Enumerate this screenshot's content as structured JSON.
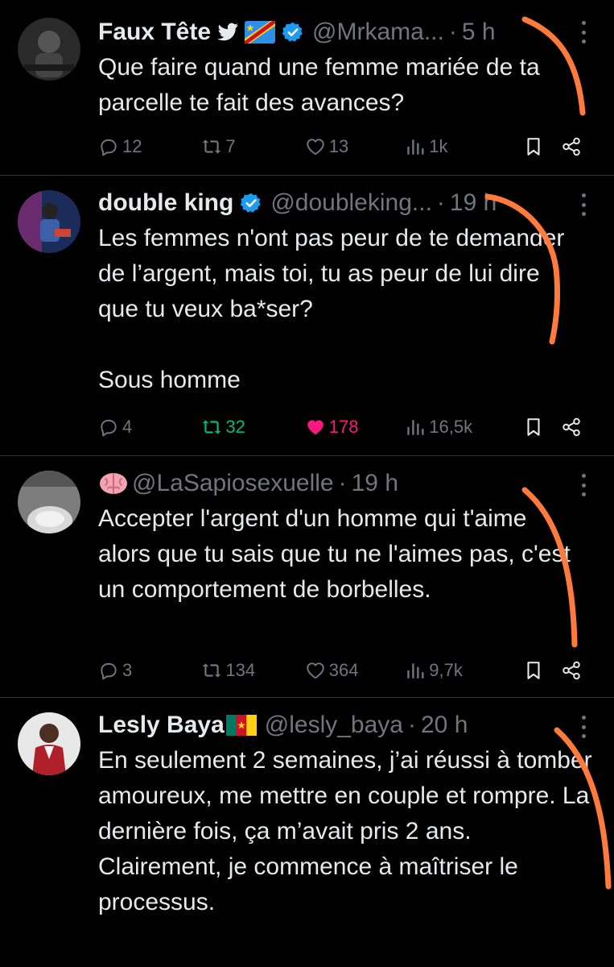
{
  "tweets": [
    {
      "name": "Faux Tête",
      "handle": "@Mrkama...",
      "time": "5 h",
      "text": "Que faire quand une femme mariée de ta parcelle te fait des avances?",
      "reply": "12",
      "retweet": "7",
      "like": "13",
      "views": "1k",
      "liked": false,
      "retweeted": false
    },
    {
      "name": "double king",
      "handle": "@doubleking...",
      "time": "19 h",
      "text": "Les femmes n'ont pas peur de te demander de l’argent, mais toi, tu as peur de lui dire que tu veux ba*ser?\n\nSous homme",
      "reply": "4",
      "retweet": "32",
      "like": "178",
      "views": "16,5k",
      "liked": true,
      "retweeted": true
    },
    {
      "name": "",
      "handle": "@LaSapiosexuelle",
      "time": "19 h",
      "text": "Accepter l'argent d'un homme qui t'aime alors que tu sais que tu ne l'aimes pas, c'est un comportement de borbelles.",
      "reply": "3",
      "retweet": "134",
      "like": "364",
      "views": "9,7k",
      "liked": false,
      "retweeted": false
    },
    {
      "name": "Lesly Baya",
      "handle": "@lesly_baya",
      "time": "20 h",
      "text": "En seulement 2 semaines, j’ai réussi à tomber amoureux, me mettre en couple et rompre. La dernière fois, ça m’avait pris 2 ans.\nClairement, je commence à maîtriser le processus.",
      "reply": "",
      "retweet": "",
      "like": "",
      "views": "",
      "liked": false,
      "retweeted": false
    }
  ],
  "dot_separator": "·",
  "colors": {
    "background": "#000000",
    "text": "#e7e9ea",
    "muted": "#71767b",
    "verified": "#1d9bf0",
    "retweet_active": "#00ba7c",
    "like_active": "#f91880",
    "annotation": "#ff7a3d"
  }
}
